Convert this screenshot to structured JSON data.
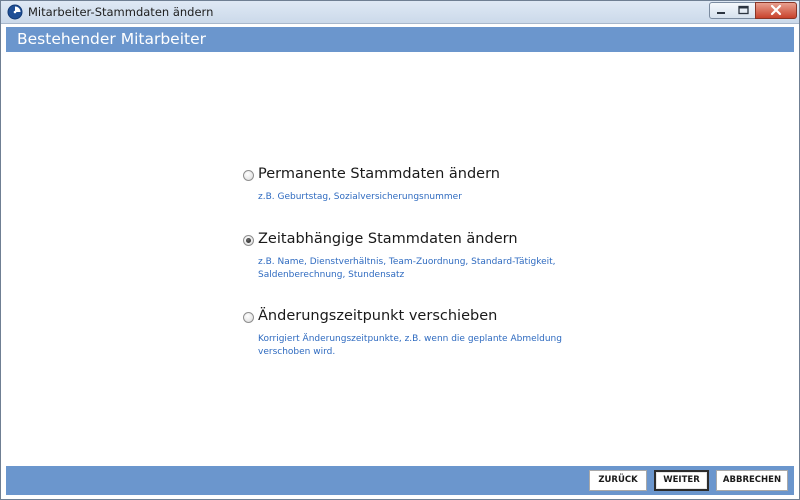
{
  "window": {
    "title": "Mitarbeiter-Stammdaten ändern",
    "icons": {
      "app": "clock-app-icon",
      "minimize": "minimize-icon",
      "maximize": "maximize-icon",
      "close": "close-icon"
    }
  },
  "header": {
    "title": "Bestehender Mitarbeiter"
  },
  "options": [
    {
      "label": "Permanente Stammdaten ändern",
      "description": "z.B. Geburtstag, Sozialversicherungsnummer",
      "checked": false
    },
    {
      "label": "Zeitabhängige Stammdaten ändern",
      "description": "z.B. Name, Dienstverhältnis, Team-Zuordnung, Standard-Tätigkeit, Saldenberechnung, Stundensatz",
      "checked": true
    },
    {
      "label": "Änderungszeitpunkt verschieben",
      "description": "Korrigiert Änderungszeitpunkte, z.B. wenn die geplante Abmeldung verschoben wird.",
      "checked": false
    }
  ],
  "footer": {
    "back_label": "ZURÜCK",
    "next_label": "WEITER",
    "cancel_label": "ABBRECHEN"
  },
  "colors": {
    "header_bar": "#6b96cd",
    "description_text": "#2f6bc0"
  }
}
